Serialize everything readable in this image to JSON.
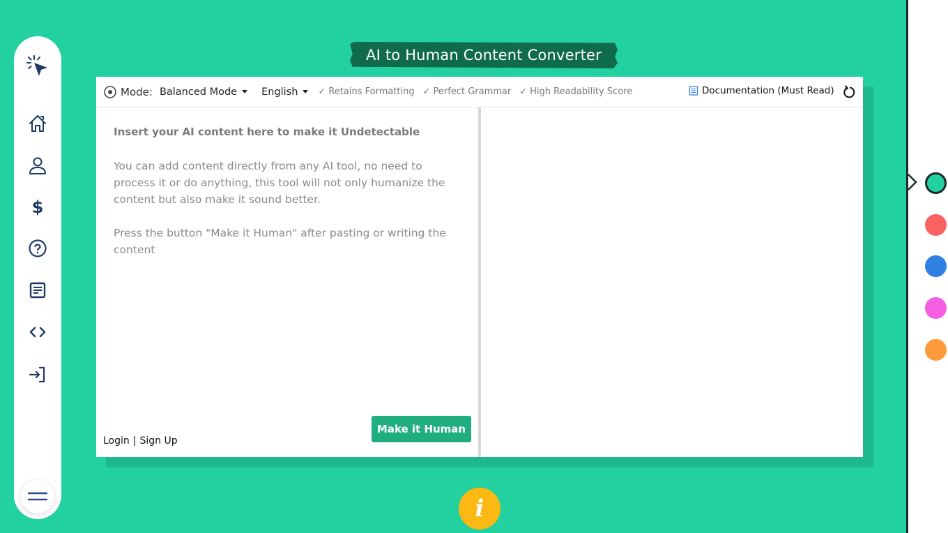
{
  "sidebar": {
    "logo": "cursor-click-logo",
    "items": [
      {
        "name": "home",
        "icon": "home-icon"
      },
      {
        "name": "profile",
        "icon": "user-icon"
      },
      {
        "name": "pricing",
        "icon": "dollar-icon"
      },
      {
        "name": "help",
        "icon": "help-circle-icon"
      },
      {
        "name": "documents",
        "icon": "document-icon"
      },
      {
        "name": "api",
        "icon": "code-icon"
      },
      {
        "name": "login",
        "icon": "login-icon"
      }
    ],
    "menu_icon": "hamburger-icon"
  },
  "header": {
    "title": "AI to Human Content Converter"
  },
  "toolbar": {
    "mode_label": "Mode:",
    "mode_value": "Balanced Mode",
    "language_value": "English",
    "features": [
      "Retains Formatting",
      "Perfect Grammar",
      "High Readability Score"
    ],
    "documentation_link": "Documentation (Must Read)"
  },
  "editor": {
    "placeholder_title": "Insert your AI content here to make it Undetectable",
    "placeholder_paragraphs": [
      "You can add content directly from any AI tool, no need to process it or do anything, this tool will not only humanize the content but also make it sound better.",
      "Press the button \"Make it Human\" after pasting or writing the content"
    ],
    "output_value": ""
  },
  "actions": {
    "make_human_label": "Make it Human",
    "login_label": "Login",
    "separator": "|",
    "signup_label": "Sign Up"
  },
  "theme_colors": {
    "active": "#22d19f",
    "swatches": [
      "#22d19f",
      "#fb6363",
      "#2f80e0",
      "#f45ee0",
      "#fd9a3a"
    ]
  },
  "colors": {
    "background": "#22d19f",
    "title_banner": "#106b4c",
    "button": "#20ae80",
    "info_button": "#fcb813",
    "icon_navy": "#1e3a64"
  }
}
